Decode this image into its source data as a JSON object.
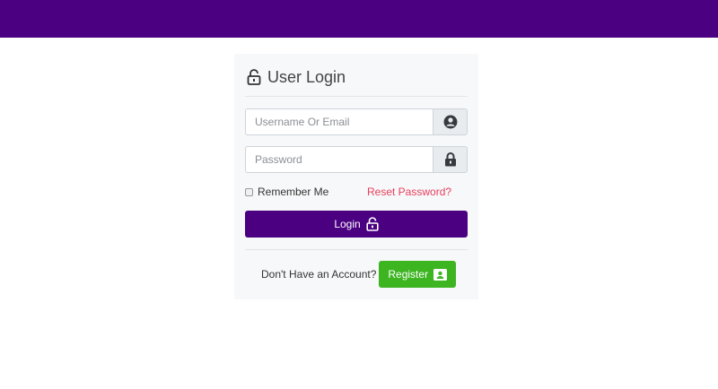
{
  "login_card": {
    "title": "User Login",
    "username_placeholder": "Username Or Email",
    "password_placeholder": "Password",
    "remember_label": "Remember Me",
    "remember_checked": false,
    "reset_link": "Reset Password?",
    "login_label": "Login",
    "no_account_text": "Don't Have an Account?",
    "register_label": "Register"
  },
  "icons": {
    "title": "lock-open-icon",
    "username": "user-circle-icon",
    "password": "lock-icon",
    "login": "lock-open-icon",
    "register": "id-card-icon"
  },
  "colors": {
    "header_bar": "#4b0082",
    "login_button": "#4b0082",
    "register_button": "#3cb521",
    "reset_link": "#e83e5c",
    "card_background": "#f7f8f9"
  }
}
